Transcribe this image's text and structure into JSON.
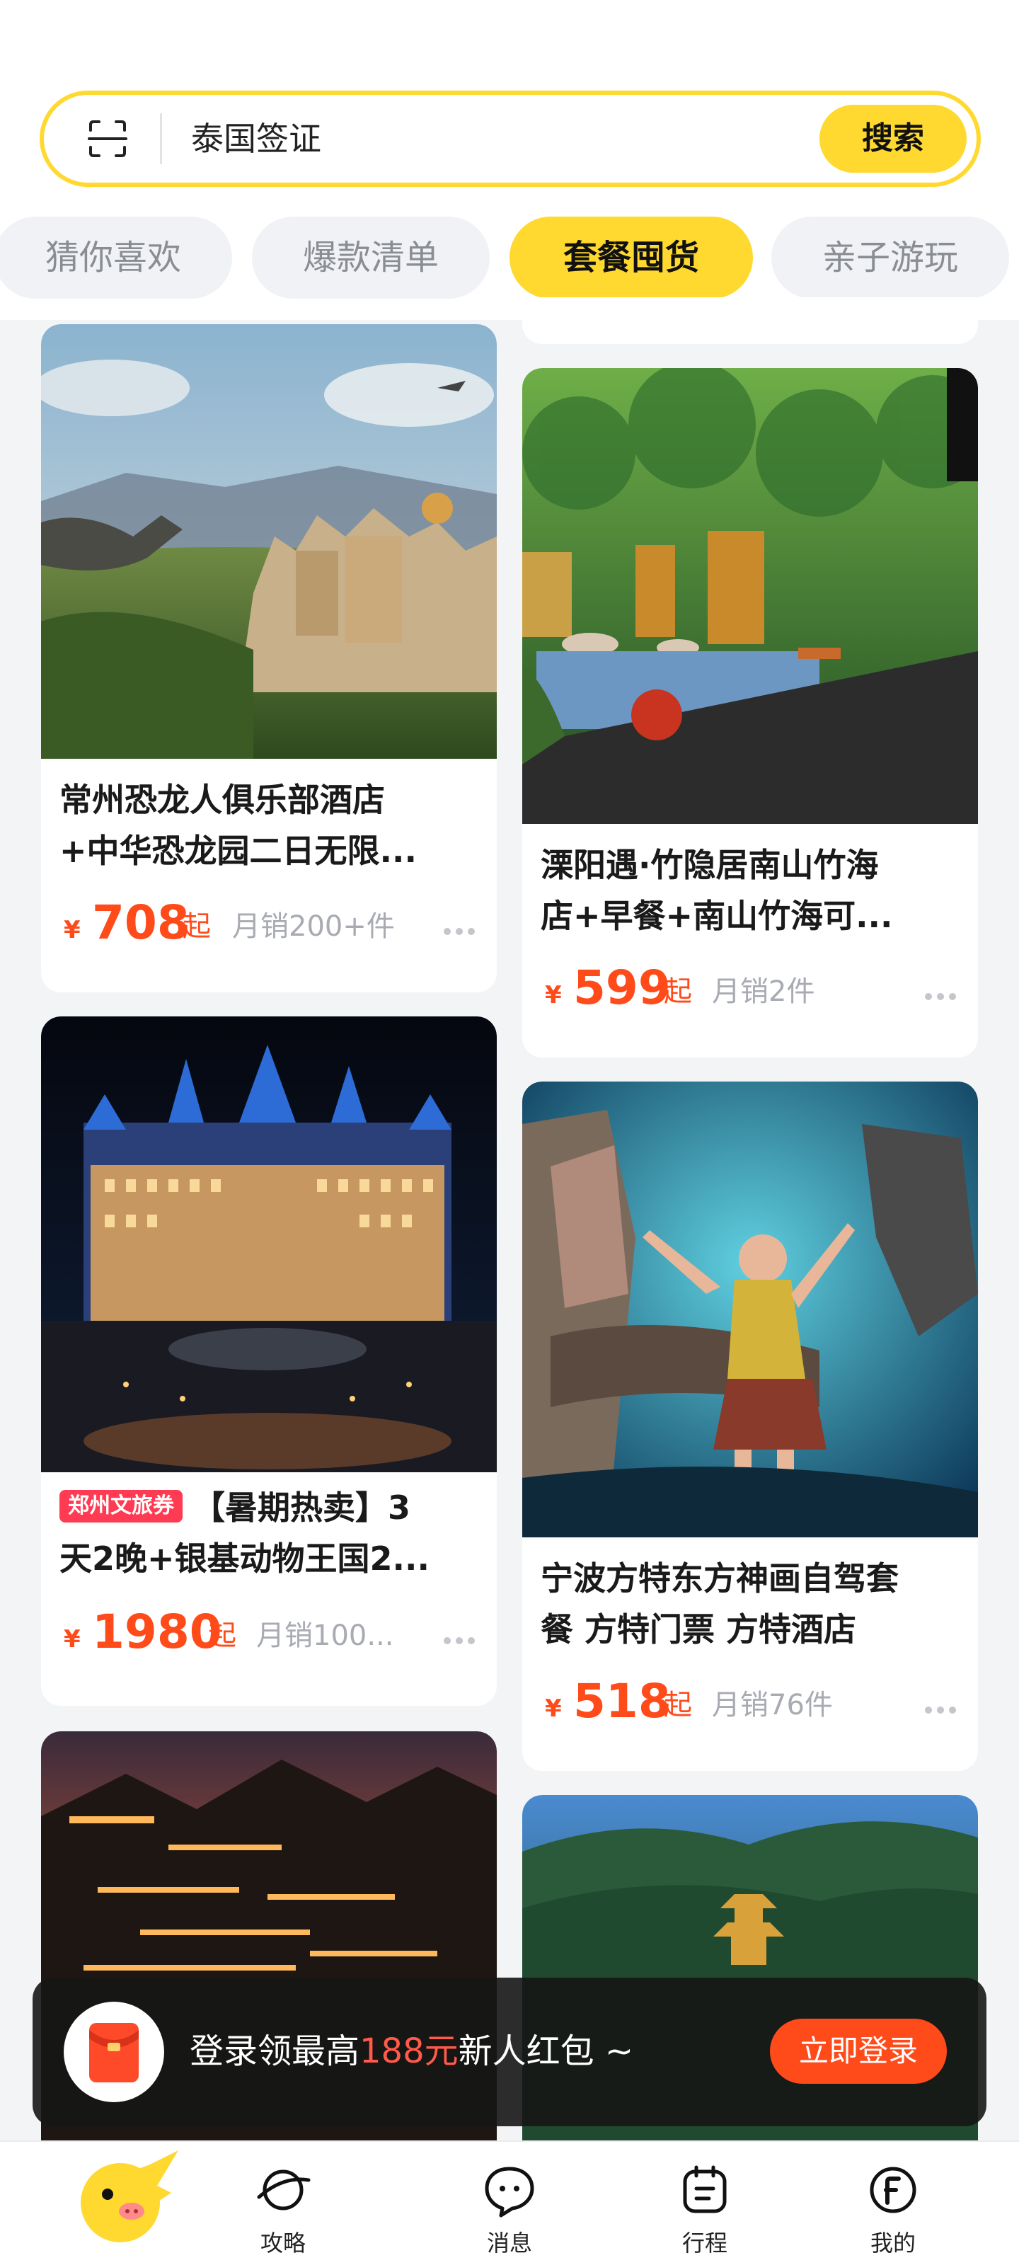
{
  "search": {
    "value": "泰国签证",
    "button_label": "搜索"
  },
  "tabs": [
    {
      "label": "猜你喜欢",
      "active": false
    },
    {
      "label": "爆款清单",
      "active": false
    },
    {
      "label": "套餐囤货",
      "active": true
    },
    {
      "label": "亲子游玩",
      "active": false
    }
  ],
  "cards": [
    {
      "title_line1": "常州恐龙人俱乐部酒店",
      "title_line2": "+中华恐龙园二日无限...",
      "currency": "¥",
      "price": "708",
      "price_suffix": "起",
      "sales": "月销200+件"
    },
    {
      "title_line1": "溧阳遇·竹隐居南山竹海",
      "title_line2": "店+早餐+南山竹海可...",
      "currency": "¥",
      "price": "599",
      "price_suffix": "起",
      "sales": "月销2件"
    },
    {
      "badge": "郑州文旅券",
      "title_line1": "【暑期热卖】3",
      "title_line2": "天2晚+银基动物王国2...",
      "currency": "¥",
      "price": "1980",
      "price_suffix": "起",
      "sales": "月销100..."
    },
    {
      "title_line1": "宁波方特东方神画自驾套",
      "title_line2": "餐 方特门票 方特酒店",
      "currency": "¥",
      "price": "518",
      "price_suffix": "起",
      "sales": "月销76件"
    }
  ],
  "login_banner": {
    "text_before": "登录领最高",
    "highlight": "188元",
    "text_after": "新人红包 ~",
    "button_label": "立即登录"
  },
  "bottom_nav": [
    {
      "label": "",
      "icon": "mascot-home-icon"
    },
    {
      "label": "攻略",
      "icon": "planet-icon"
    },
    {
      "label": "消息",
      "icon": "chat-bubble-icon"
    },
    {
      "label": "行程",
      "icon": "itinerary-icon"
    },
    {
      "label": "我的",
      "icon": "profile-f-icon"
    }
  ],
  "colors": {
    "brand_yellow": "#ffd92f",
    "price_red": "#ff4a1a",
    "badge_red": "#ff3b53",
    "background": "#f3f4f6"
  }
}
